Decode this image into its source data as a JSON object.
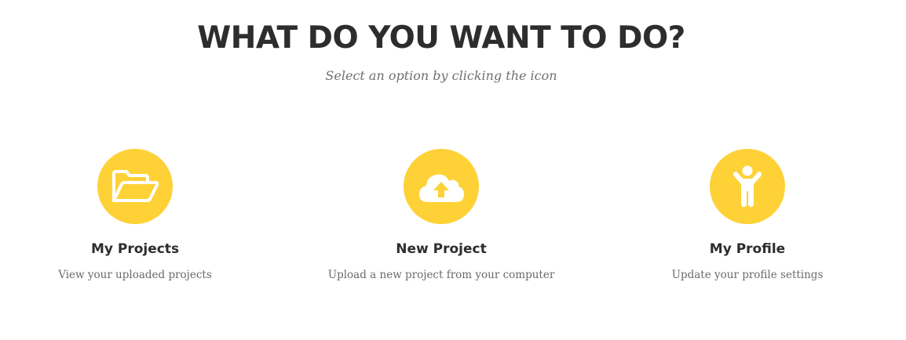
{
  "header": {
    "title": "WHAT DO YOU WANT TO DO?",
    "subtitle": "Select an option by clicking the icon"
  },
  "theme": {
    "accent": "#fed136",
    "heading_color": "#2d2d2d",
    "text_muted": "#6f6f6f"
  },
  "options": [
    {
      "icon": "folder-open-icon",
      "title": "My Projects",
      "description": "View your uploaded projects"
    },
    {
      "icon": "cloud-upload-icon",
      "title": "New Project",
      "description": "Upload a new project from your computer"
    },
    {
      "icon": "child-person-icon",
      "title": "My Profile",
      "description": "Update your profile settings"
    }
  ]
}
